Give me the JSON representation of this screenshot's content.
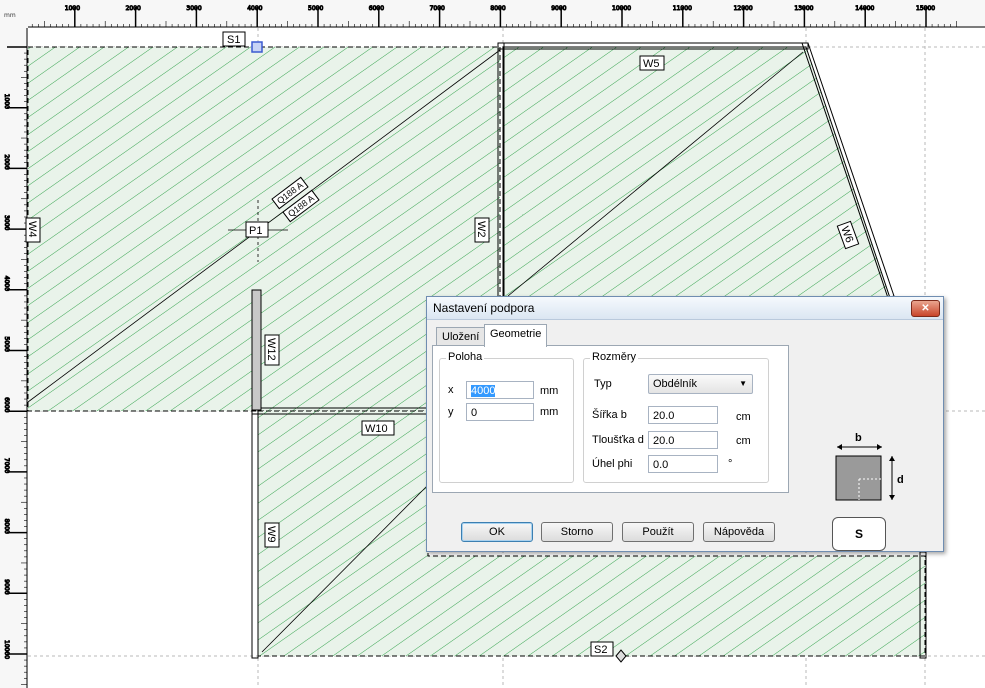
{
  "ruler": {
    "unit": "mm",
    "x_ticks": [
      "1000",
      "2000",
      "3000",
      "4000",
      "5000",
      "6000",
      "7000",
      "8000",
      "9000",
      "10000",
      "11000",
      "12000",
      "13000",
      "14000",
      "15000"
    ],
    "y_ticks": [
      "1000",
      "2000",
      "3000",
      "4000",
      "5000",
      "6000",
      "7000",
      "8000",
      "9000",
      "10000"
    ]
  },
  "plan_labels": {
    "s1": "S1",
    "s2": "S2",
    "w5": "W5",
    "w2": "W2",
    "w6": "W6",
    "w4": "W4",
    "w12": "W12",
    "w10": "W10",
    "w9": "W9",
    "p1": "P1",
    "q188_1": "Q188 A",
    "q188_2": "Q188 A"
  },
  "colors": {
    "hatch": "#3aa552",
    "fill": "#e9f3ea",
    "selected_support": "#3c5bd0"
  },
  "dialog": {
    "title": "Nastavení podpora",
    "close_icon": "close-icon",
    "tabs": [
      {
        "label": "Uložení",
        "active": false
      },
      {
        "label": "Geometrie",
        "active": true
      }
    ],
    "poloha": {
      "title": "Poloha",
      "x_label": "x",
      "x_value": "4000",
      "x_unit": "mm",
      "y_label": "y",
      "y_value": "0",
      "y_unit": "mm"
    },
    "rozmery": {
      "title": "Rozměry",
      "typ_label": "Typ",
      "typ_value": "Obdélník",
      "sirka_label": "Šířka b",
      "sirka_value": "20.0",
      "sirka_unit": "cm",
      "tloustka_label": "Tloušťka d",
      "tloustka_value": "20.0",
      "tloustka_unit": "cm",
      "uhel_label": "Úhel phi",
      "uhel_value": "0.0",
      "uhel_unit": "°"
    },
    "preview": {
      "b_label": "b",
      "d_label": "d",
      "s_label": "S"
    },
    "buttons": {
      "ok": "OK",
      "storno": "Storno",
      "pouzit": "Použít",
      "napoveda": "Nápověda"
    }
  }
}
